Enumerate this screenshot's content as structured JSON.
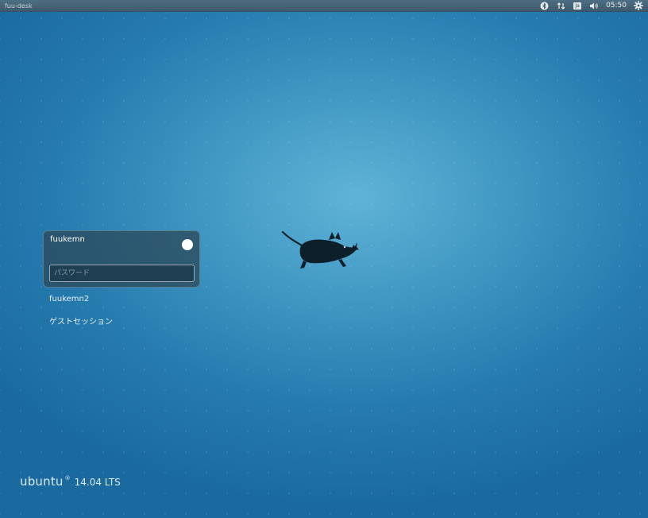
{
  "top_panel": {
    "hostname": "fuu-desk",
    "keyboard_layout": "Ja",
    "clock": "05:50",
    "indicators": [
      "bluetooth-icon",
      "network-icon",
      "keyboard-icon",
      "volume-icon",
      "gear-icon"
    ]
  },
  "login": {
    "selected_user": "fuukemn",
    "password_placeholder": "パスワード",
    "password_value": "",
    "other_users": [
      "fuukemn2"
    ],
    "guest_session_label": "ゲストセッション"
  },
  "branding": {
    "os_name": "ubuntu",
    "registered_mark": "®",
    "version": "14.04 LTS"
  },
  "colors": {
    "background_center": "#5fb3d6",
    "background_edge": "#1a6aa0",
    "panel_bg": "#3e5a6d"
  }
}
